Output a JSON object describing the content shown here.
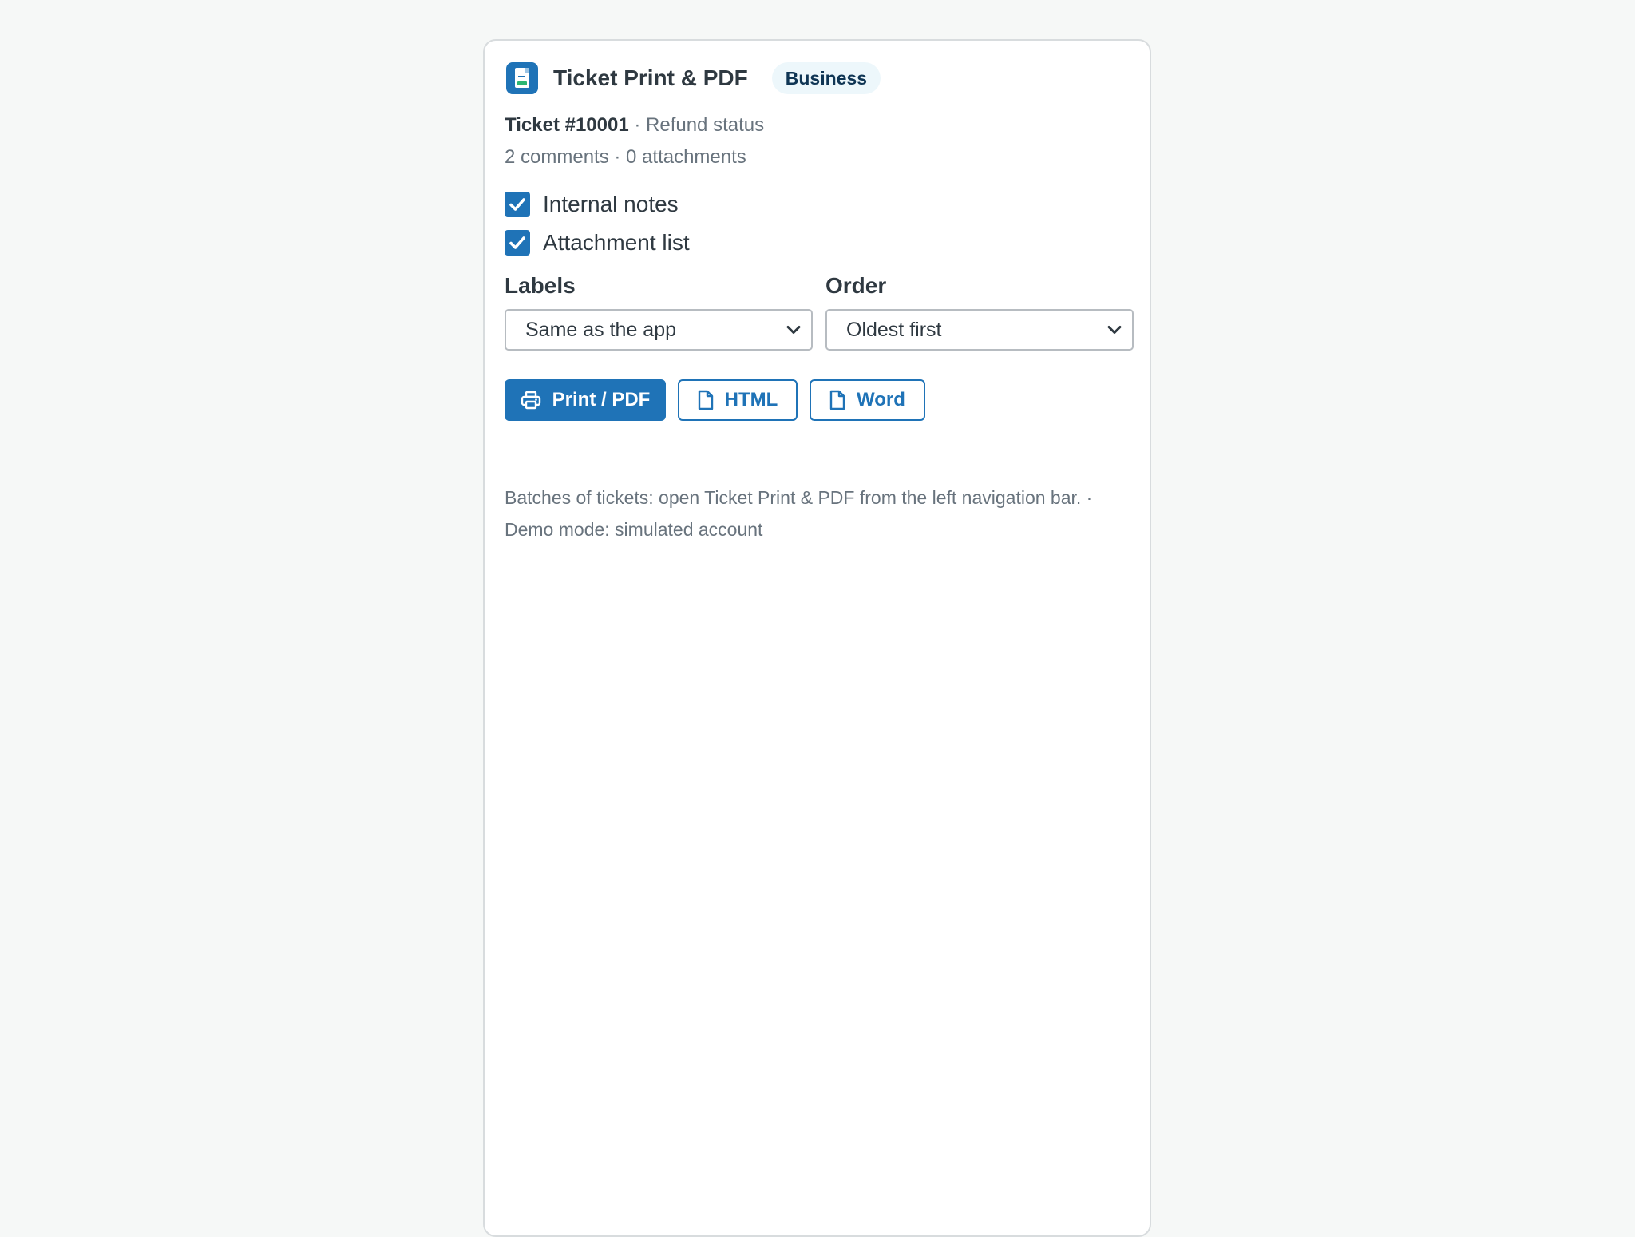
{
  "app": {
    "title": "Ticket Print & PDF",
    "plan_badge": "Business",
    "icon": "document-icon",
    "accent_color": "#1f73b7"
  },
  "ticket": {
    "id": "Ticket #10001",
    "separator": " · ",
    "subject": "Refund status",
    "counts": "2 comments · 0 attachments"
  },
  "options": {
    "internal_notes": {
      "label": "Internal notes",
      "checked": true
    },
    "attachment_list": {
      "label": "Attachment list",
      "checked": true
    }
  },
  "labels_select": {
    "label": "Labels",
    "value": "Same as the app"
  },
  "order_select": {
    "label": "Order",
    "value": "Oldest first"
  },
  "actions": {
    "print_label": "Print / PDF",
    "print_icon": "printer-icon",
    "html_label": "HTML",
    "html_icon": "file-icon",
    "word_label": "Word",
    "word_icon": "file-icon"
  },
  "footnote": {
    "text": "Batches of tickets: open Ticket Print & PDF from the left navigation bar. · Demo mode: simulated account"
  }
}
